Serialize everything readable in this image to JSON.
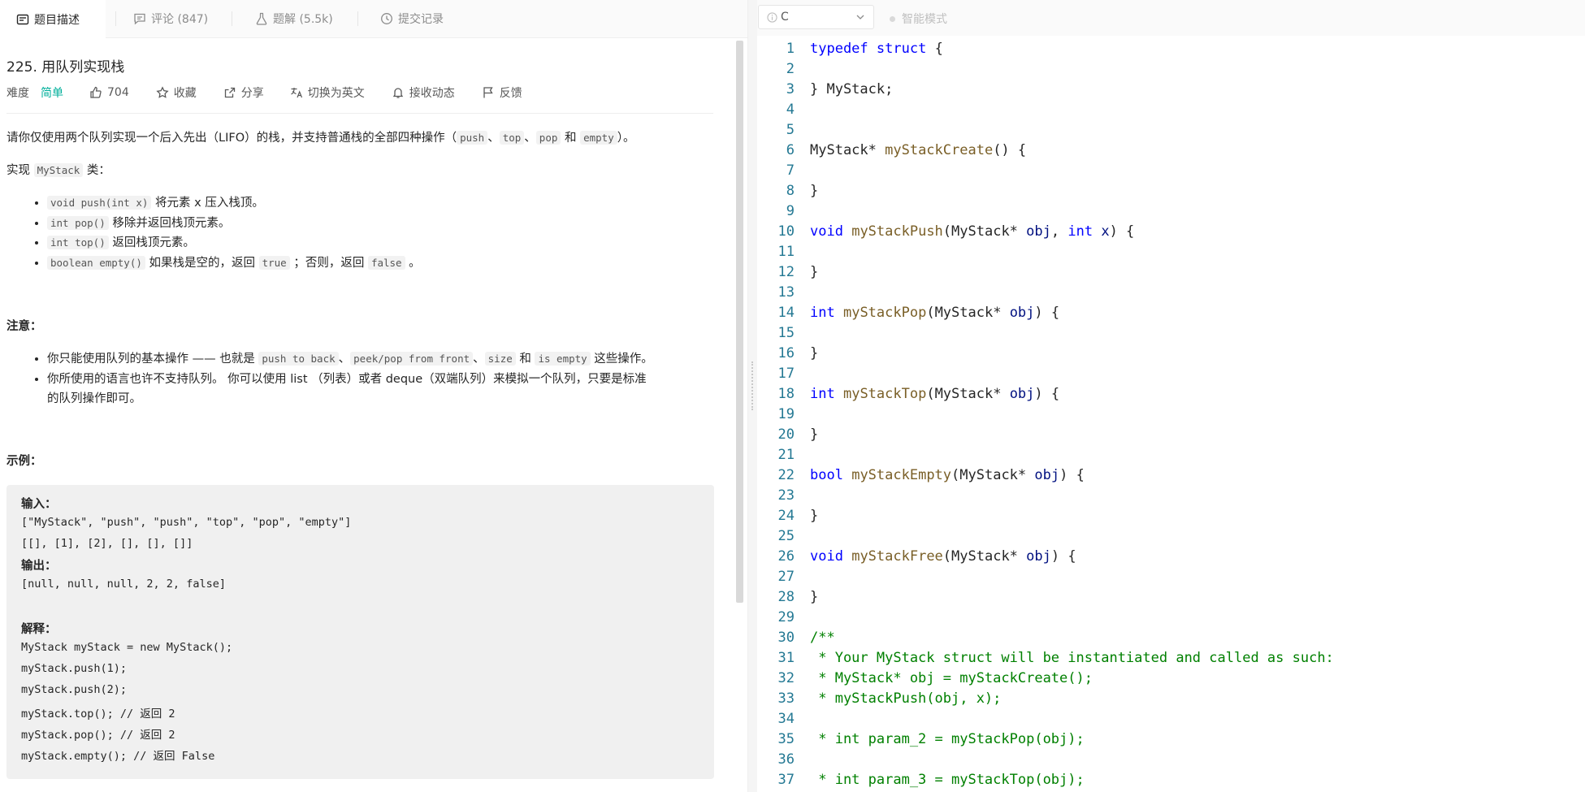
{
  "tabs": [
    {
      "label": "题目描述",
      "icon": "description-icon"
    },
    {
      "label": "评论 (847)",
      "icon": "comment-icon"
    },
    {
      "label": "题解 (5.5k)",
      "icon": "flask-icon"
    },
    {
      "label": "提交记录",
      "icon": "clock-icon"
    }
  ],
  "problem": {
    "title": "225. 用队列实现栈",
    "difficulty_label": "难度",
    "difficulty": "简单",
    "likes": "704",
    "favorite": "收藏",
    "share": "分享",
    "switch_lang": "切换为英文",
    "subscribe": "接收动态",
    "feedback": "反馈",
    "intro_pre": "请你仅使用两个队列实现一个后入先出（LIFO）的栈，并支持普通栈的全部四种操作（",
    "intro_push": "push",
    "sep1": "、",
    "intro_top": "top",
    "sep2": "、",
    "intro_pop": "pop",
    "intro_and": " 和 ",
    "intro_empty": "empty",
    "intro_post": "）。",
    "impl_pre": "实现 ",
    "impl_class": "MyStack",
    "impl_post": " 类：",
    "methods": [
      {
        "code": "void push(int x)",
        "desc": " 将元素 x 压入栈顶。"
      },
      {
        "code": "int pop()",
        "desc": " 移除并返回栈顶元素。"
      },
      {
        "code": "int top()",
        "desc": " 返回栈顶元素。"
      },
      {
        "code": "boolean empty()",
        "desc": " 如果栈是空的，返回 ",
        "code2": "true",
        "desc2": " ；否则，返回 ",
        "code3": "false",
        "desc3": " 。"
      }
    ],
    "note_heading": "注意：",
    "note1_pre": "你只能使用队列的基本操作 —— 也就是 ",
    "note1_c1": "push to back",
    "note1_s1": "、",
    "note1_c2": "peek/pop from front",
    "note1_s2": "、",
    "note1_c3": "size",
    "note1_and": " 和 ",
    "note1_c4": "is empty",
    "note1_post": " 这些操作。",
    "note2_line1": "你所使用的语言也许不支持队列。 你可以使用 list （列表）或者 deque（双端队列）来模拟一个队列，只要是标准",
    "note2_line2": "的队列操作即可。",
    "example_heading": "示例："
  },
  "example": {
    "input_label": "输入：",
    "input_line1": "[\"MyStack\", \"push\", \"push\", \"top\", \"pop\", \"empty\"]",
    "input_line2": "[[], [1], [2], [], [], []]",
    "output_label": "输出：",
    "output_line": "[null, null, null, 2, 2, false]",
    "explain_label": "解释：",
    "explain_lines": [
      "MyStack myStack = new MyStack();",
      "myStack.push(1);",
      "myStack.push(2);",
      "myStack.top(); // 返回 2",
      "myStack.pop(); // 返回 2",
      "myStack.empty(); // 返回 False"
    ]
  },
  "editor": {
    "language": "C",
    "smart_mode": "智能模式",
    "line_numbers": [
      "1",
      "2",
      "3",
      "4",
      "5",
      "6",
      "7",
      "8",
      "9",
      "10",
      "11",
      "12",
      "13",
      "14",
      "15",
      "16",
      "17",
      "18",
      "19",
      "20",
      "21",
      "22",
      "23",
      "24",
      "25",
      "26",
      "27",
      "28",
      "29",
      "30",
      "31",
      "32",
      "33",
      "34",
      "35",
      "36",
      "37"
    ],
    "code": {
      "l1_kw1": "typedef",
      "l1_kw2": "struct",
      "l1_rest": " {",
      "l3": "} MyStack;",
      "l6_type": "MyStack* ",
      "l6_fn": "myStackCreate",
      "l6_rest": "() {",
      "l8": "}",
      "l10_kw": "void",
      "l10_fn": "myStackPush",
      "l10_a": "(MyStack* ",
      "l10_v1": "obj",
      "l10_b": ", ",
      "l10_kw2": "int",
      "l10_v2": "x",
      "l10_c": ") {",
      "l12": "}",
      "l14_kw": "int",
      "l14_fn": "myStackPop",
      "l14_a": "(MyStack* ",
      "l14_v": "obj",
      "l14_b": ") {",
      "l16": "}",
      "l18_kw": "int",
      "l18_fn": "myStackTop",
      "l18_a": "(MyStack* ",
      "l18_v": "obj",
      "l18_b": ") {",
      "l20": "}",
      "l22_kw": "bool",
      "l22_fn": "myStackEmpty",
      "l22_a": "(MyStack* ",
      "l22_v": "obj",
      "l22_b": ") {",
      "l24": "}",
      "l26_kw": "void",
      "l26_fn": "myStackFree",
      "l26_a": "(MyStack* ",
      "l26_v": "obj",
      "l26_b": ") {",
      "l28": "}",
      "l30": "/**",
      "l31": " * Your MyStack struct will be instantiated and called as such:",
      "l32": " * MyStack* obj = myStackCreate();",
      "l33": " * myStackPush(obj, x);",
      "l35": " * int param_2 = myStackPop(obj);",
      "l37": " * int param_3 = myStackTop(obj);"
    }
  }
}
